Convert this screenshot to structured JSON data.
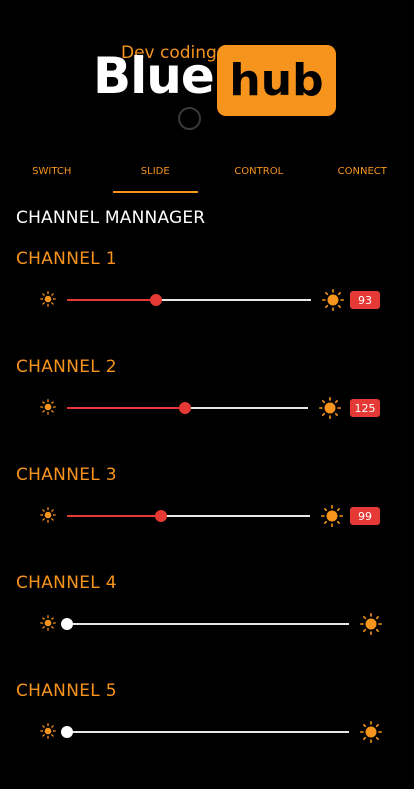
{
  "logo": {
    "tagline": "Dev coding",
    "word_left": "Blue",
    "word_right": "hub"
  },
  "tabs": [
    {
      "label": "SWITCH",
      "active": false
    },
    {
      "label": "SLIDE",
      "active": true
    },
    {
      "label": "CONTROL",
      "active": false
    },
    {
      "label": "CONNECT",
      "active": false
    }
  ],
  "section_title": "CHANNEL MANNAGER",
  "channels": [
    {
      "label": "CHANNEL 1",
      "value": "93",
      "max": 255
    },
    {
      "label": "CHANNEL 2",
      "value": "125",
      "max": 255
    },
    {
      "label": "CHANNEL 3",
      "value": "99",
      "max": 255
    },
    {
      "label": "CHANNEL 4",
      "value": "0",
      "max": 255
    },
    {
      "label": "CHANNEL 5",
      "value": "0",
      "max": 255
    }
  ],
  "colors": {
    "accent": "#f7941d",
    "slider_fill": "#e53935",
    "background": "#000000"
  },
  "icons": {
    "brightness_low": "sun-small-icon",
    "brightness_high": "sun-large-icon"
  }
}
